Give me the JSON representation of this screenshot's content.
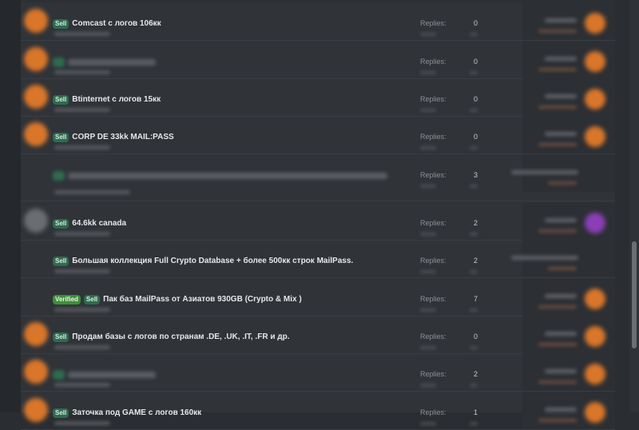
{
  "threads": [
    {
      "prefixes": [
        "Sell"
      ],
      "title": "Comcast с логов 106кк",
      "replies_label": "Replies:",
      "replies": "0",
      "avatar": "orange",
      "latest_avatar": "orange",
      "blurred": false
    },
    {
      "prefixes": [],
      "title": "",
      "replies_label": "Replies:",
      "replies": "0",
      "avatar": "orange",
      "latest_avatar": "orange",
      "blurred": true
    },
    {
      "prefixes": [
        "Sell"
      ],
      "title": "Btinternet с логов 15кк",
      "replies_label": "Replies:",
      "replies": "0",
      "avatar": "orange",
      "latest_avatar": "orange",
      "blurred": false
    },
    {
      "prefixes": [
        "Sell"
      ],
      "title": "CORP DE 33kk MAIL:PASS",
      "replies_label": "Replies:",
      "replies": "0",
      "avatar": "orange",
      "latest_avatar": "orange",
      "blurred": false
    },
    {
      "prefixes": [],
      "title": "",
      "replies_label": "Replies:",
      "replies": "3",
      "avatar": "none",
      "latest_avatar": "none",
      "blurred": true
    },
    {
      "prefixes": [
        "Sell"
      ],
      "title": "64.6kk canada",
      "replies_label": "Replies:",
      "replies": "2",
      "avatar": "grey",
      "latest_avatar": "purple",
      "blurred": false
    },
    {
      "prefixes": [
        "Sell"
      ],
      "title": "Большая коллекция Full Crypto Database + более 500кк строк MailPass.",
      "replies_label": "Replies:",
      "replies": "2",
      "avatar": "none",
      "latest_avatar": "none",
      "blurred": false
    },
    {
      "prefixes": [
        "Verified",
        "Sell"
      ],
      "title": "Пак баз MailPass от Азиатов 930GB (Crypto & Mix )",
      "replies_label": "Replies:",
      "replies": "7",
      "avatar": "none",
      "latest_avatar": "orange",
      "blurred": false
    },
    {
      "prefixes": [
        "Sell"
      ],
      "title": "Продам базы с логов по странам .DE, .UK, .IT, .FR и др.",
      "replies_label": "Replies:",
      "replies": "0",
      "avatar": "orange",
      "latest_avatar": "orange",
      "blurred": false
    },
    {
      "prefixes": [],
      "title": "",
      "replies_label": "Replies:",
      "replies": "2",
      "avatar": "orange",
      "latest_avatar": "orange",
      "blurred": true
    },
    {
      "prefixes": [
        "Sell"
      ],
      "title": "Заточка под GAME с логов 160кк",
      "replies_label": "Replies:",
      "replies": "1",
      "avatar": "orange",
      "latest_avatar": "orange",
      "blurred": false
    }
  ],
  "colors": {
    "sell_tag": "#2e6b4f",
    "verified_tag": "#3d8f3a",
    "avatar_orange": "#d9762a",
    "avatar_purple": "#8a3fb5"
  }
}
